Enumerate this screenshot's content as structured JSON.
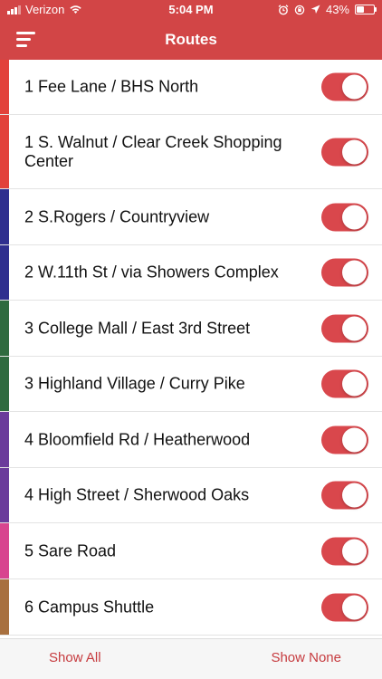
{
  "status": {
    "carrier": "Verizon",
    "time": "5:04 PM",
    "battery": "43%",
    "battery_level": 0.43,
    "icons": [
      "signal-icon",
      "wifi-icon",
      "alarm-icon",
      "orientation-lock-icon",
      "location-arrow-icon",
      "battery-icon"
    ]
  },
  "nav": {
    "title": "Routes",
    "menu_icon": "hamburger-menu-icon"
  },
  "colors": {
    "accent": "#d24546",
    "toggle_on": "#d9474c",
    "stripes": {
      "route1": "#e2413a",
      "route2": "#2f2f8f",
      "route3": "#2f6b3f",
      "route4": "#6b3b9b",
      "route5": "#d8458f",
      "route6": "#a8703f"
    }
  },
  "routes": [
    {
      "label": "1 Fee Lane / BHS North",
      "on": true,
      "color": "#e2413a"
    },
    {
      "label": "1 S. Walnut / Clear Creek Shopping Center",
      "on": true,
      "color": "#e2413a"
    },
    {
      "label": "2 S.Rogers / Countryview",
      "on": true,
      "color": "#2f2f8f"
    },
    {
      "label": "2 W.11th St / via Showers Complex",
      "on": true,
      "color": "#2f2f8f"
    },
    {
      "label": "3 College Mall / East 3rd Street",
      "on": true,
      "color": "#2f6b3f"
    },
    {
      "label": "3 Highland Village / Curry Pike",
      "on": true,
      "color": "#2f6b3f"
    },
    {
      "label": "4 Bloomfield Rd / Heatherwood",
      "on": true,
      "color": "#6b3b9b"
    },
    {
      "label": "4 High Street / Sherwood Oaks",
      "on": true,
      "color": "#6b3b9b"
    },
    {
      "label": "5 Sare Road",
      "on": true,
      "color": "#d8458f"
    },
    {
      "label": "6 Campus Shuttle",
      "on": true,
      "color": "#a8703f"
    }
  ],
  "bottom": {
    "show_all": "Show All",
    "show_none": "Show None"
  }
}
